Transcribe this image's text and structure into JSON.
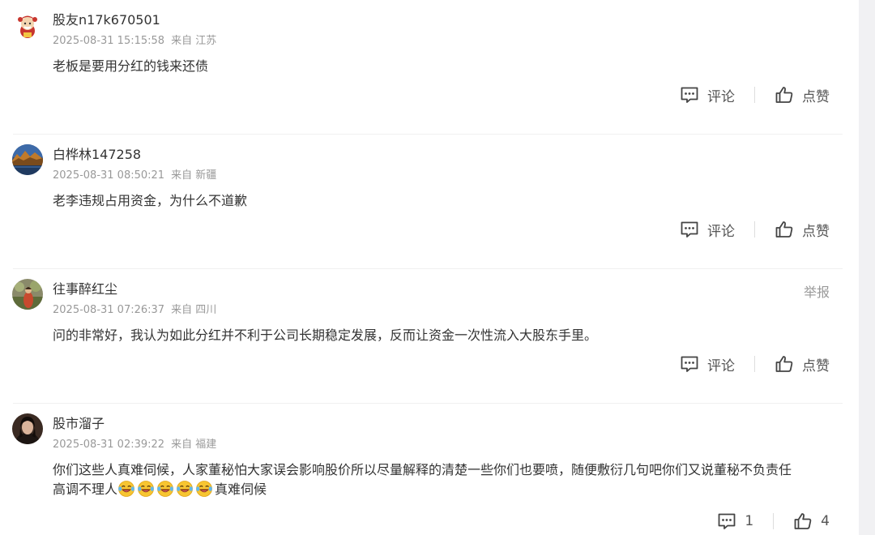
{
  "comments": [
    {
      "username": "股友n17k670501",
      "time": "2025-08-31 15:15:58",
      "location": "来自 江苏",
      "content": "老板是要用分红的钱来还债",
      "comment_label": "评论",
      "like_label": "点赞",
      "avatar": "cartoon-avatar"
    },
    {
      "username": "白桦林147258",
      "time": "2025-08-31 08:50:21",
      "location": "来自 新疆",
      "content": "老李违规占用资金，为什么不道歉",
      "comment_label": "评论",
      "like_label": "点赞",
      "avatar": "landscape-avatar"
    },
    {
      "username": "往事醉红尘",
      "time": "2025-08-31 07:26:37",
      "location": "来自 四川",
      "content": "问的非常好，我认为如此分红并不利于公司长期稳定发展，反而让资金一次性流入大股东手里。",
      "comment_label": "评论",
      "like_label": "点赞",
      "report_label": "举报",
      "avatar": "photo-avatar"
    },
    {
      "username": "股市溜子",
      "time": "2025-08-31 02:39:22",
      "location": "来自 福建",
      "content_line1": "你们这些人真难伺候，人家董秘怕大家误会影响股价所以尽量解释的清楚一些你们也要喷，随便敷衍几句吧你们又说董秘不负责任",
      "content_line2_prefix": "高调不理人",
      "content_line2_suffix": "真难伺候",
      "emoji": "laughing-tears-emoji",
      "emoji_count": 5,
      "comment_count": "1",
      "like_count": "4",
      "avatar": "portrait-avatar"
    }
  ],
  "colors": {
    "text": "#333333",
    "meta": "#999999",
    "divider": "#f0f0f0",
    "icon": "#444444"
  }
}
